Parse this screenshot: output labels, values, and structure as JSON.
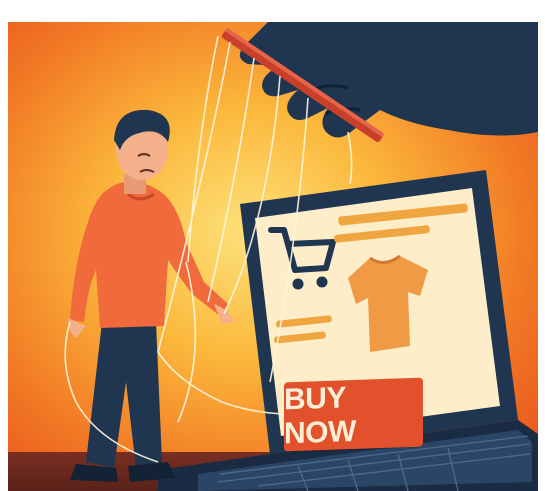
{
  "illustration": {
    "button_label": "BUY NOW",
    "icons": [
      "shopping-cart-icon",
      "t-shirt-icon",
      "puppeteer-hand-icon",
      "laptop-icon"
    ],
    "colors": {
      "background_warm": "#f06a24",
      "background_glow": "#fde17a",
      "screen": "#fdeec9",
      "button": "#e2512b",
      "navy": "#1f3550",
      "shirt": "#f09a45",
      "person_shirt": "#f06a3c"
    }
  }
}
